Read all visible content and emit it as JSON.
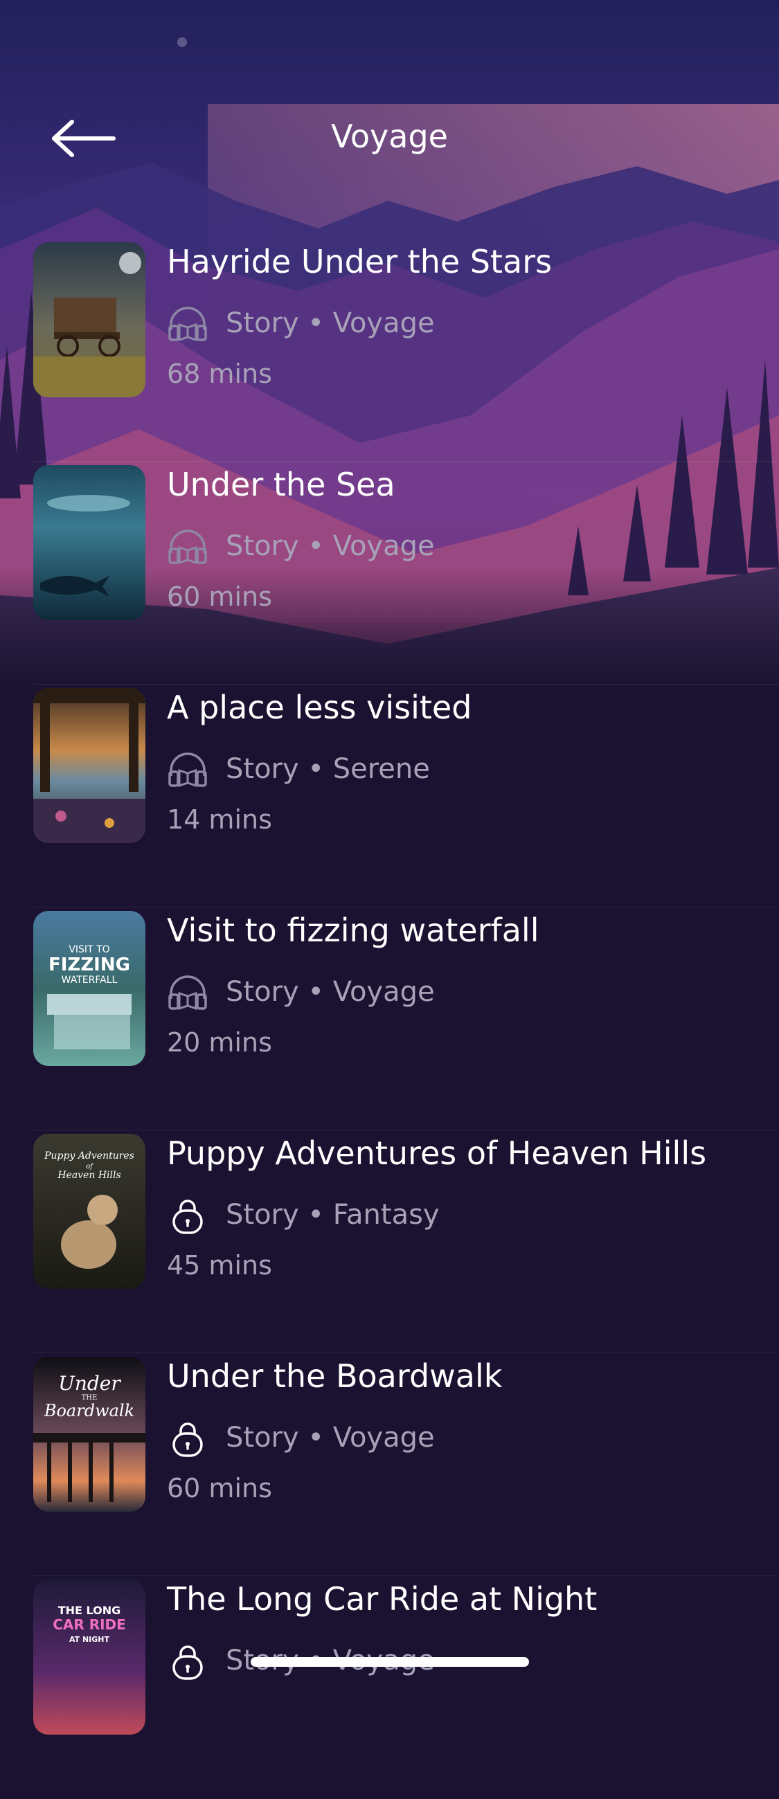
{
  "header": {
    "title": "Voyage"
  },
  "colors": {
    "background": "#1a1230",
    "meta_text": "#a8a2b8",
    "title_text": "#ffffff"
  },
  "items": [
    {
      "title": "Hayride Under the Stars",
      "icon": "headphones-icon",
      "meta": "Story • Voyage",
      "duration": "68 mins"
    },
    {
      "title": "Under the Sea",
      "icon": "headphones-icon",
      "meta": "Story • Voyage",
      "duration": "60 mins"
    },
    {
      "title": "A place less visited",
      "icon": "headphones-icon",
      "meta": "Story • Serene",
      "duration": "14 mins"
    },
    {
      "title": "Visit to fizzing waterfall",
      "icon": "headphones-icon",
      "meta": "Story • Voyage",
      "duration": "20 mins",
      "cover_text": [
        "VISIT TO",
        "FIZZING",
        "WATERFALL"
      ]
    },
    {
      "title": "Puppy Adventures of Heaven Hills",
      "icon": "lock-icon",
      "meta": "Story • Fantasy",
      "duration": "45 mins",
      "cover_text": [
        "Puppy Adventures",
        "of",
        "Heaven Hills"
      ]
    },
    {
      "title": "Under the Boardwalk",
      "icon": "lock-icon",
      "meta": "Story • Voyage",
      "duration": "60 mins",
      "cover_text": [
        "Under",
        "THE",
        "Boardwalk"
      ]
    },
    {
      "title": "The Long Car Ride at Night",
      "icon": "lock-icon",
      "meta": "Story • Voyage",
      "duration": "",
      "cover_text": [
        "THE LONG",
        "CAR RIDE",
        "AT NIGHT"
      ]
    }
  ]
}
